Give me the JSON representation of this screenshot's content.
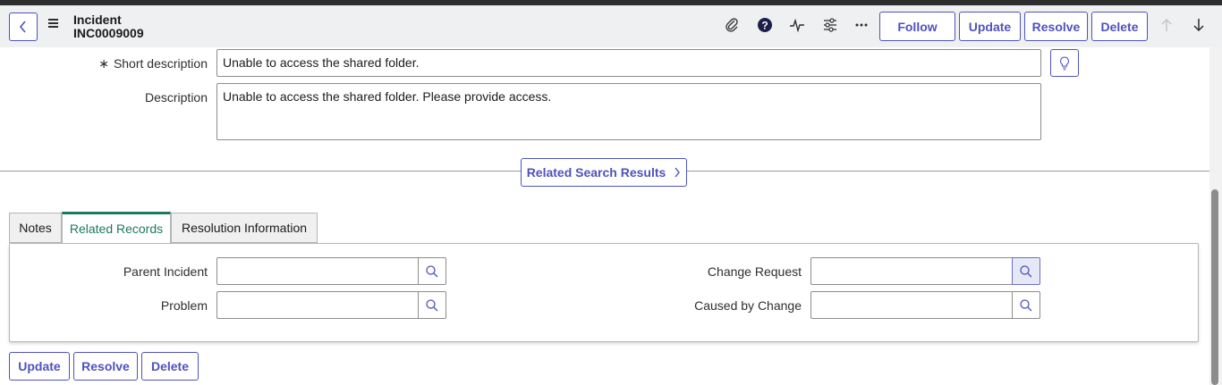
{
  "header": {
    "record_type": "Incident",
    "record_number": "INC0009009",
    "icons": [
      "paperclip-icon",
      "help-icon",
      "activity-icon",
      "settings-sliders-icon",
      "more-icon",
      "arrow-up-icon",
      "arrow-down-icon"
    ],
    "buttons": {
      "follow": "Follow",
      "update": "Update",
      "resolve": "Resolve",
      "delete": "Delete"
    }
  },
  "form": {
    "required_marker": "∗",
    "short_description": {
      "label": "Short description",
      "value": "Unable to access the shared folder."
    },
    "description": {
      "label": "Description",
      "value": "Unable to access the shared folder. Please provide access."
    },
    "related_search": "Related Search Results"
  },
  "tabs": [
    {
      "label": "Notes",
      "active": false
    },
    {
      "label": "Related Records",
      "active": true
    },
    {
      "label": "Resolution Information",
      "active": false
    }
  ],
  "related_records": {
    "parent_incident": {
      "label": "Parent Incident",
      "value": ""
    },
    "problem": {
      "label": "Problem",
      "value": ""
    },
    "change_request": {
      "label": "Change Request",
      "value": ""
    },
    "caused_by_change": {
      "label": "Caused by Change",
      "value": ""
    }
  },
  "footer": {
    "update": "Update",
    "resolve": "Resolve",
    "delete": "Delete"
  },
  "colors": {
    "accent": "#4f52bd",
    "active_tab": "#1b7a5a",
    "header_bg": "#eef0f2"
  }
}
